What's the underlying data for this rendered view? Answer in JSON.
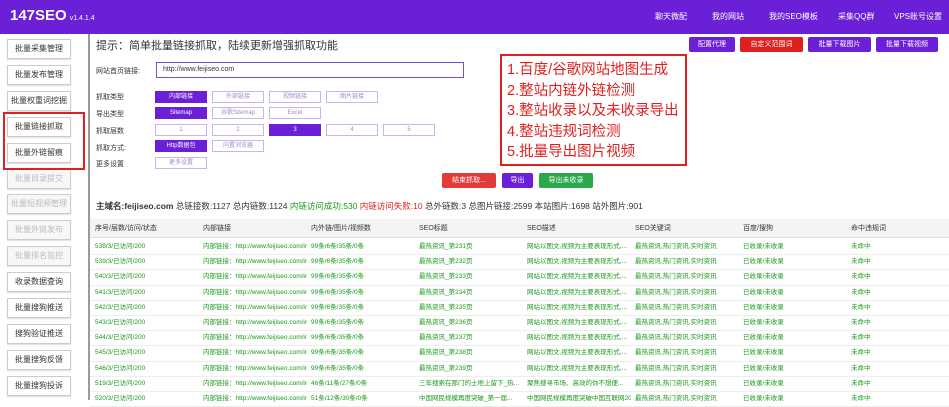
{
  "app": {
    "logo": "147SEO",
    "version": "v1.4.1.4"
  },
  "nav": [
    "聊天微配",
    "我的网站",
    "我的SEO模板",
    "采集QQ群",
    "VPS账号设置"
  ],
  "sidebar": [
    {
      "label": "批量采集管理",
      "enabled": true
    },
    {
      "label": "批量发布管理",
      "enabled": true
    },
    {
      "label": "批量权重词挖掘",
      "enabled": true
    },
    {
      "label": "批量链接抓取",
      "enabled": true
    },
    {
      "label": "批量外链留痕",
      "enabled": true
    },
    {
      "label": "批量目录提交",
      "enabled": false
    },
    {
      "label": "批量短视频管理",
      "enabled": false
    },
    {
      "label": "批量外链发布",
      "enabled": false
    },
    {
      "label": "批量排名监控",
      "enabled": false
    },
    {
      "label": "收录数据查询",
      "enabled": true
    },
    {
      "label": "批量搜狗推送",
      "enabled": true
    },
    {
      "label": "搜狗验证推送",
      "enabled": true
    },
    {
      "label": "批量搜狗反馈",
      "enabled": true
    },
    {
      "label": "批量搜狗投诉",
      "enabled": true
    }
  ],
  "hint": "提示：简单批量链接抓取，陆续更新增强抓取功能",
  "top_buttons": [
    {
      "label": "配置代理",
      "color": "#6b1fd6"
    },
    {
      "label": "自定义范围词",
      "color": "#e02020"
    },
    {
      "label": "批量下载图片",
      "color": "#6b1fd6"
    },
    {
      "label": "批量下载视频",
      "color": "#6b1fd6"
    }
  ],
  "form": {
    "url_label": "网站首页链接:",
    "url_value": "http://www.feijiseo.com",
    "crawl_type_label": "抓取类型",
    "crawl_types": [
      "内部链接",
      "外部链接",
      "视频链接",
      "图片链接"
    ],
    "export_type_label": "导出类型",
    "export_types": [
      "Sitemap",
      "谷歌Sitemap",
      "Excel"
    ],
    "depth_label": "抓取层数",
    "depths": [
      "1",
      "2",
      "3",
      "4",
      "5"
    ],
    "method_label": "抓取方式:",
    "methods": [
      "Http数据包",
      "内置浏览器"
    ],
    "more_label": "更多设置",
    "more_button": "更多设置"
  },
  "actions": [
    {
      "label": "结束抓取...",
      "color": "#e33a3a"
    },
    {
      "label": "导出",
      "color": "#6b1fd6"
    },
    {
      "label": "导出未收录",
      "color": "#2aa84a"
    }
  ],
  "stats": {
    "domain": "主域名:feijiseo.com",
    "total": "总链接数:1127",
    "internal": "总内链数:1124",
    "ok": "内链访问成功:530",
    "fail": "内链访问失败:10",
    "external": "总外链数:3",
    "images": "总图片链接:2599",
    "site_images": "本站图片:1698",
    "offsite_images": "站外图片:901"
  },
  "callout": [
    "1.百度/谷歌网站地图生成",
    "2.整站内链外链检测",
    "3.整站收录以及未收录导出",
    "4.整站违规词检测",
    "5.批量导出图片视频"
  ],
  "table": {
    "columns": [
      "序号/层数/访问/状态",
      "内部链接",
      "内外链/图片/视频数",
      "SEO标题",
      "SEO描述",
      "SEO关键词",
      "百度/搜狗",
      "命中违规词"
    ],
    "rows": [
      [
        "538/3/已访问/200",
        "内部链接：http://www.feijiseo.com/ind",
        "99条/6条/35条/0条",
        "最热资讯_第231页",
        "网站以图文,视频为主要表现形式,...",
        "最热资讯,热门资讯,实时资讯",
        "已收录/未收录",
        "未命中"
      ],
      [
        "539/3/已访问/200",
        "内部链接：http://www.feijiseo.com/ind",
        "99条/6条/35条/0条",
        "最热资讯_第232页",
        "网站以图文,视频为主要表现形式,...",
        "最热资讯,热门资讯,实时资讯",
        "已收录/未收录",
        "未命中"
      ],
      [
        "540/3/已访问/200",
        "内部链接：http://www.feijiseo.com/ind",
        "99条/6条/35条/0条",
        "最热资讯_第233页",
        "网站以图文,视频为主要表现形式,...",
        "最热资讯,热门资讯,实时资讯",
        "已收录/未收录",
        "未命中"
      ],
      [
        "541/3/已访问/200",
        "内部链接：http://www.feijiseo.com/ind",
        "99条/6条/35条/0条",
        "最热资讯_第234页",
        "网站以图文,视频为主要表现形式,...",
        "最热资讯,热门资讯,实时资讯",
        "已收录/未收录",
        "未命中"
      ],
      [
        "542/3/已访问/200",
        "内部链接：http://www.feijiseo.com/ind",
        "99条/6条/35条/0条",
        "最热资讯_第235页",
        "网站以图文,视频为主要表现形式,...",
        "最热资讯,热门资讯,实时资讯",
        "已收录/未收录",
        "未命中"
      ],
      [
        "543/3/已访问/200",
        "内部链接：http://www.feijiseo.com/ind",
        "99条/6条/35条/0条",
        "最热资讯_第236页",
        "网站以图文,视频为主要表现形式,...",
        "最热资讯,热门资讯,实时资讯",
        "已收录/未收录",
        "未命中"
      ],
      [
        "544/3/已访问/200",
        "内部链接：http://www.feijiseo.com/ind",
        "99条/6条/35条/0条",
        "最热资讯_第237页",
        "网站以图文,视频为主要表现形式,...",
        "最热资讯,热门资讯,实时资讯",
        "已收录/未收录",
        "未命中"
      ],
      [
        "545/3/已访问/200",
        "内部链接：http://www.feijiseo.com/ind",
        "99条/6条/35条/0条",
        "最热资讯_第238页",
        "网站以图文,视频为主要表现形式,...",
        "最热资讯,热门资讯,实时资讯",
        "已收录/未收录",
        "未命中"
      ],
      [
        "546/3/已访问/200",
        "内部链接：http://www.feijiseo.com/ind",
        "99条/6条/35条/0条",
        "最热资讯_第239页",
        "网站以图文,视频为主要表现形式,...",
        "最热资讯,热门资讯,实时资讯",
        "已收录/未收录",
        "未命中"
      ],
      [
        "519/3/已访问/200",
        "内部链接：http://www.feijiseo.com/ind",
        "46条/11条/27条/0条",
        "三年搜索在那门的土地上留下_热...",
        "聚焦搜寻市场、高效的你不想便...",
        "最热资讯,热门资讯,实时资讯",
        "已收录/未收录",
        "未命中"
      ],
      [
        "520/3/已访问/200",
        "内部链接：http://www.feijiseo.com/ind",
        "51条/12条/30条/0条",
        "中国网民规模再度突破_第一届...",
        "中国网民规模再度突破中国互联网2022...",
        "最热资讯,热门资讯,实时资讯",
        "已收录/未收录",
        "未命中"
      ]
    ]
  }
}
